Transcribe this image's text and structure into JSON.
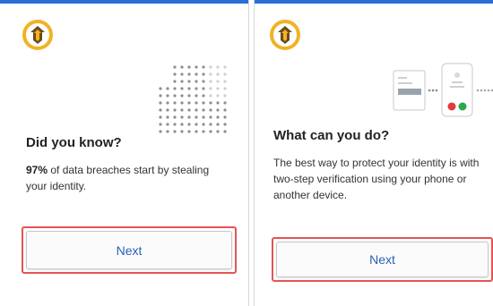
{
  "colors": {
    "accent_bar": "#2b6fd6",
    "logo_ring": "#f0b323",
    "button_text": "#2b5fb8",
    "highlight_border": "#e45454"
  },
  "icons": {
    "logo": "shield-arrow-logo-icon",
    "left_illustration": "dot-grid-illustration",
    "right_illustration": "two-step-verification-illustration"
  },
  "cards": [
    {
      "title": "Did you know?",
      "desc_strong": "97%",
      "desc_rest": " of data breaches start by stealing your identity.",
      "button_label": "Next"
    },
    {
      "title": "What can you do?",
      "desc": "The best way to protect your identity is with two-step verification using your phone or another device.",
      "button_label": "Next"
    }
  ]
}
